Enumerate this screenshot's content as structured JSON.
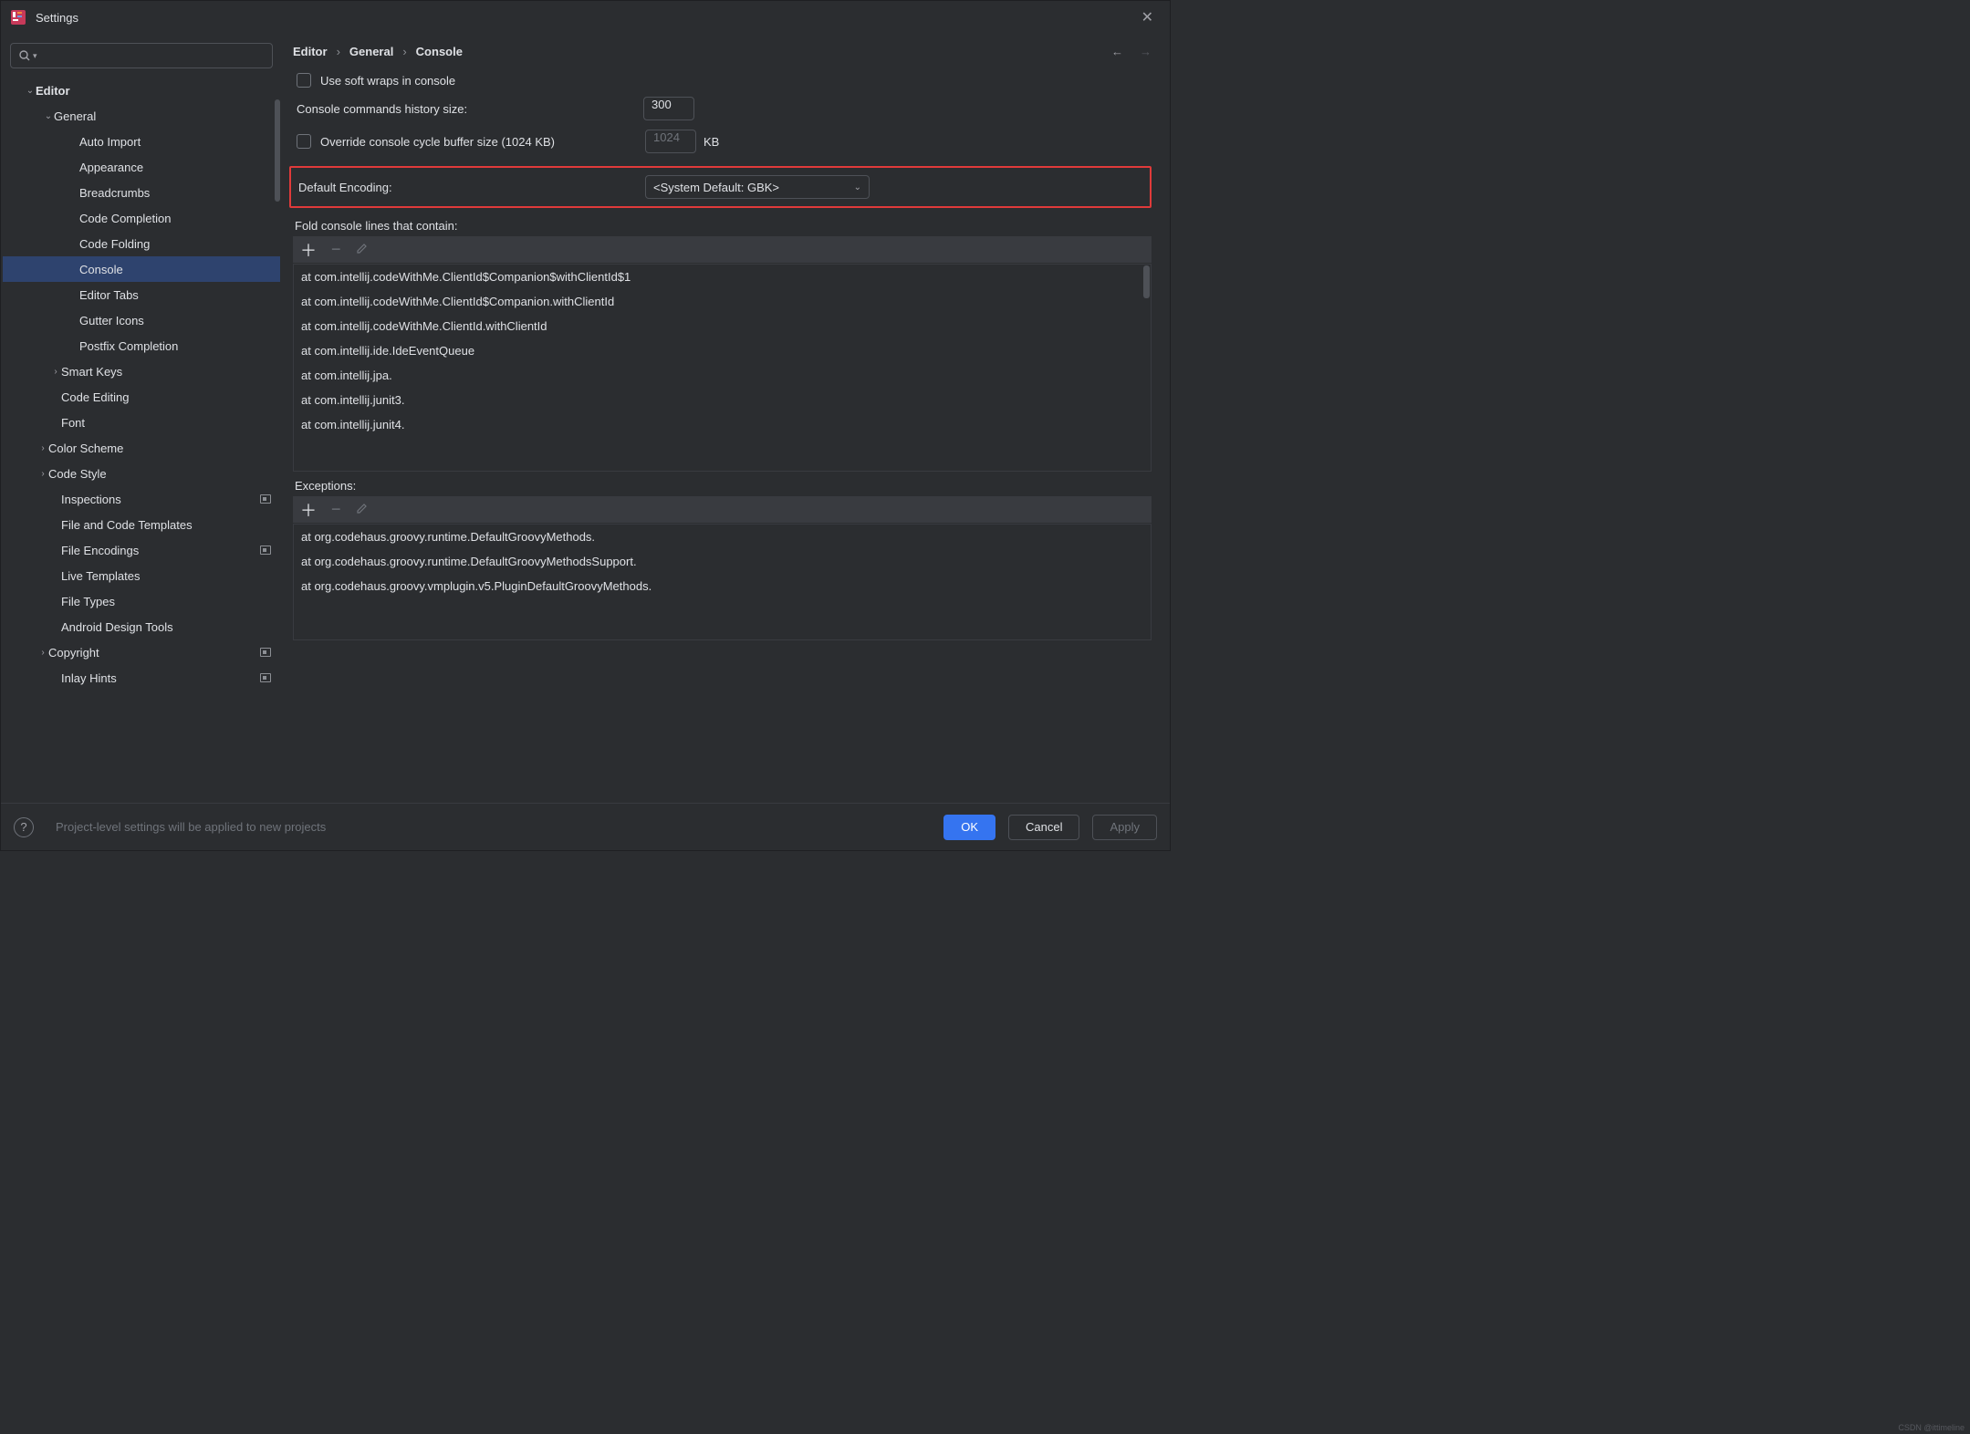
{
  "window": {
    "title": "Settings"
  },
  "search": {
    "placeholder": ""
  },
  "tree": [
    {
      "label": "Editor",
      "indent": 24,
      "chev": "down",
      "bold": true
    },
    {
      "label": "General",
      "indent": 44,
      "chev": "down"
    },
    {
      "label": "Auto Import",
      "indent": 70
    },
    {
      "label": "Appearance",
      "indent": 70
    },
    {
      "label": "Breadcrumbs",
      "indent": 70
    },
    {
      "label": "Code Completion",
      "indent": 70
    },
    {
      "label": "Code Folding",
      "indent": 70
    },
    {
      "label": "Console",
      "indent": 70,
      "selected": true
    },
    {
      "label": "Editor Tabs",
      "indent": 70
    },
    {
      "label": "Gutter Icons",
      "indent": 70
    },
    {
      "label": "Postfix Completion",
      "indent": 70
    },
    {
      "label": "Smart Keys",
      "indent": 52,
      "chev": "right"
    },
    {
      "label": "Code Editing",
      "indent": 50
    },
    {
      "label": "Font",
      "indent": 50
    },
    {
      "label": "Color Scheme",
      "indent": 38,
      "chev": "right"
    },
    {
      "label": "Code Style",
      "indent": 38,
      "chev": "right"
    },
    {
      "label": "Inspections",
      "indent": 50,
      "badge": true
    },
    {
      "label": "File and Code Templates",
      "indent": 50
    },
    {
      "label": "File Encodings",
      "indent": 50,
      "badge": true
    },
    {
      "label": "Live Templates",
      "indent": 50
    },
    {
      "label": "File Types",
      "indent": 50
    },
    {
      "label": "Android Design Tools",
      "indent": 50
    },
    {
      "label": "Copyright",
      "indent": 38,
      "chev": "right",
      "badge": true
    },
    {
      "label": "Inlay Hints",
      "indent": 50,
      "badge": true
    }
  ],
  "breadcrumb": [
    "Editor",
    "General",
    "Console"
  ],
  "form": {
    "soft_wraps": "Use soft wraps in console",
    "history_label": "Console commands history size:",
    "history_value": "300",
    "override_label": "Override console cycle buffer size (1024 KB)",
    "override_value": "1024",
    "override_suffix": "KB",
    "encoding_label": "Default Encoding:",
    "encoding_value": "<System Default: GBK>",
    "fold_label": "Fold console lines that contain:",
    "fold_items": [
      "at com.intellij.codeWithMe.ClientId$Companion$withClientId$1",
      "at com.intellij.codeWithMe.ClientId$Companion.withClientId",
      "at com.intellij.codeWithMe.ClientId.withClientId",
      "at com.intellij.ide.IdeEventQueue",
      "at com.intellij.jpa.",
      "at com.intellij.junit3.",
      "at com.intellij.junit4."
    ],
    "exc_label": "Exceptions:",
    "exc_items": [
      "at org.codehaus.groovy.runtime.DefaultGroovyMethods.",
      "at org.codehaus.groovy.runtime.DefaultGroovyMethodsSupport.",
      "at org.codehaus.groovy.vmplugin.v5.PluginDefaultGroovyMethods."
    ]
  },
  "footer": {
    "hint": "Project-level settings will be applied to new projects",
    "ok": "OK",
    "cancel": "Cancel",
    "apply": "Apply"
  },
  "watermark": "CSDN @ittimeline"
}
